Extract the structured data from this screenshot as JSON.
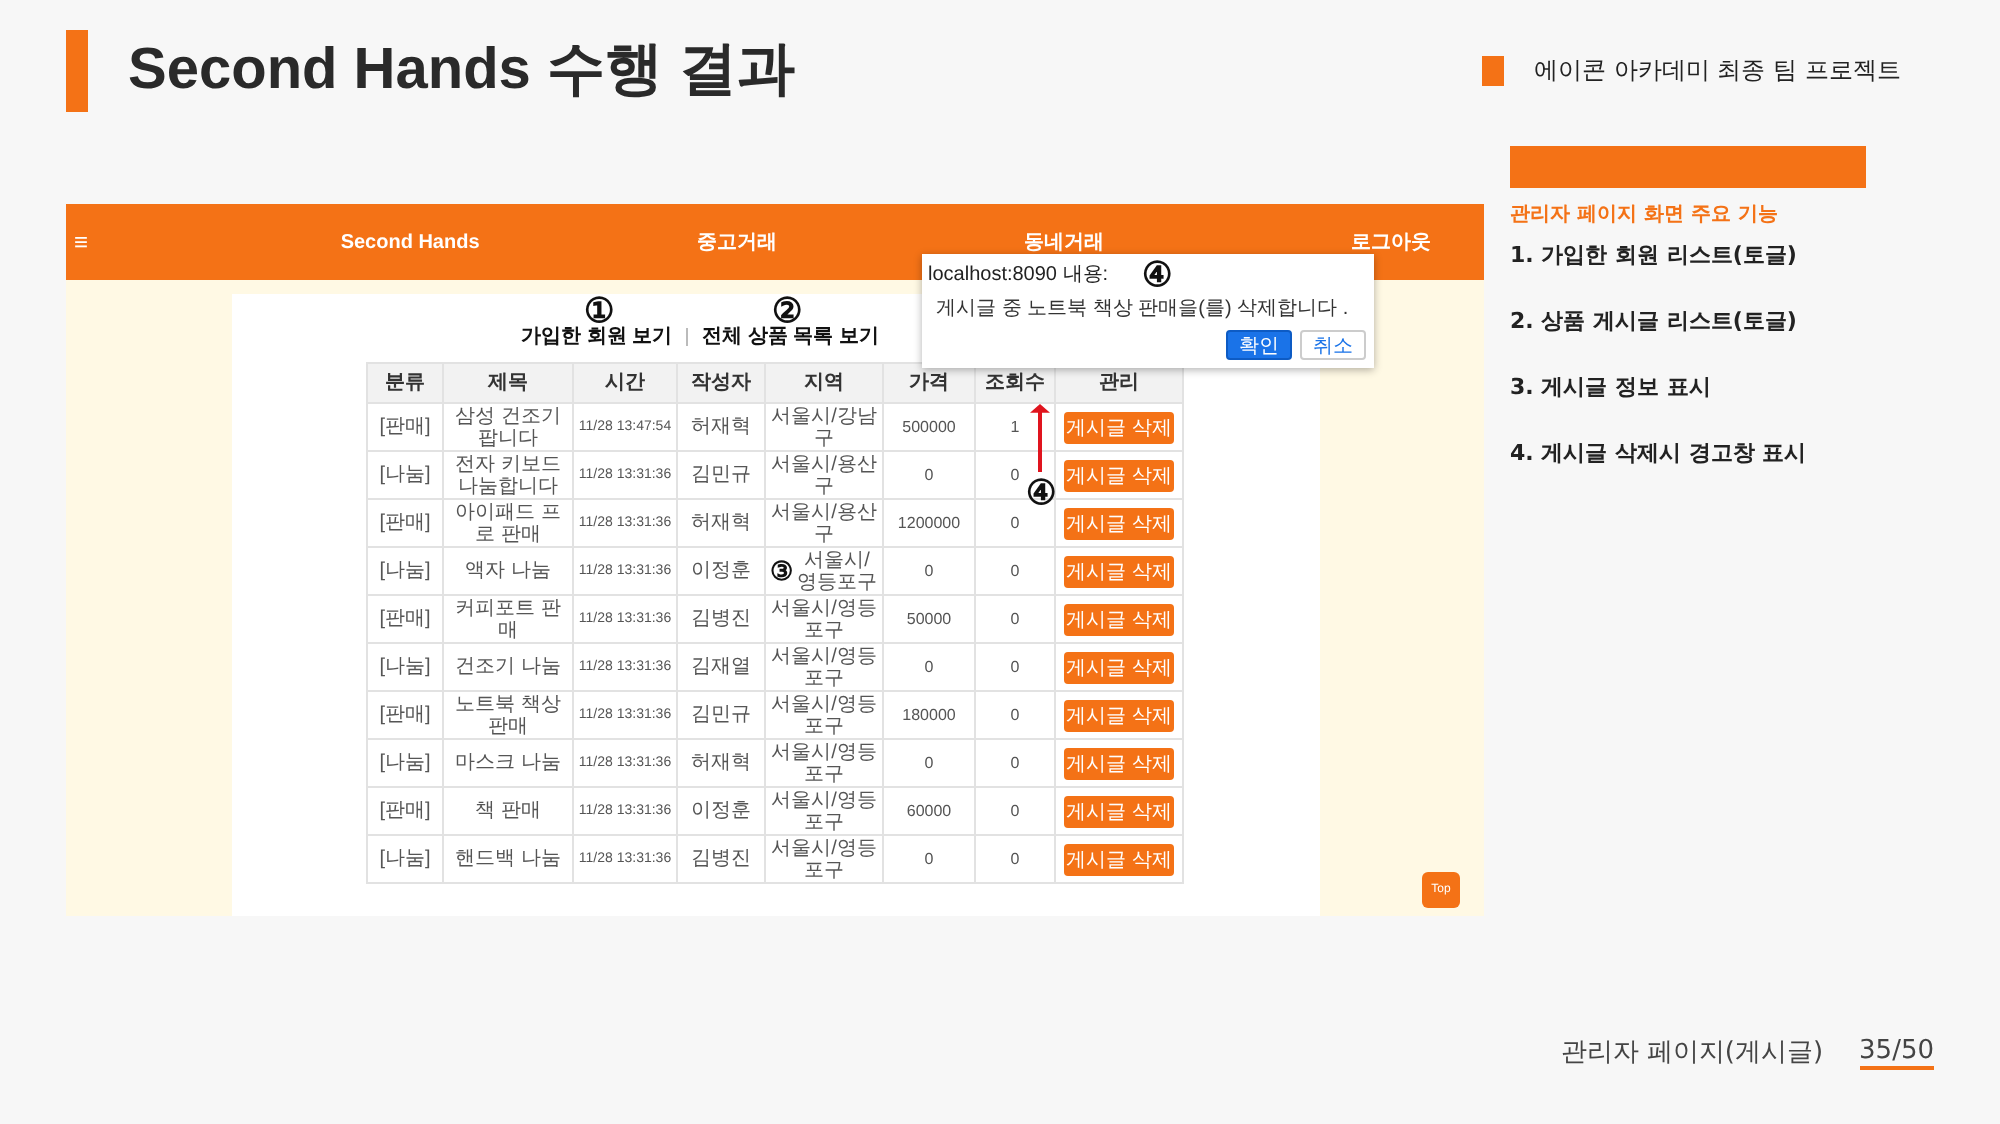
{
  "slide": {
    "title": "Second Hands 수행 결과",
    "project": "에이콘 아카데미 최종 팀 프로젝트"
  },
  "app": {
    "menu_icon": "≡",
    "nav": [
      "Second Hands",
      "중고거래",
      "동네거래",
      "로그아웃"
    ],
    "toggles": [
      {
        "label": "가입한 회원 보기"
      },
      {
        "label": "전체 상품 목록 보기"
      }
    ],
    "table": {
      "columns": [
        "분류",
        "제목",
        "시간",
        "작성자",
        "지역",
        "가격",
        "조회수",
        "관리"
      ],
      "rows": [
        {
          "cells": [
            "[판매]",
            "삼성 건조기 팝니다",
            "11/28 13:47:54",
            "허재혁",
            "서울시/강남구",
            "500000",
            "1"
          ],
          "action": "게시글 삭제"
        },
        {
          "cells": [
            "[나눔]",
            "전자 키보드 나눔합니다",
            "11/28 13:31:36",
            "김민규",
            "서울시/용산구",
            "0",
            "0"
          ],
          "action": "게시글 삭제"
        },
        {
          "cells": [
            "[판매]",
            "아이패드 프로 판매",
            "11/28 13:31:36",
            "허재혁",
            "서울시/용산구",
            "1200000",
            "0"
          ],
          "action": "게시글 삭제"
        },
        {
          "cells": [
            "[나눔]",
            "액자 나눔",
            "11/28 13:31:36",
            "이정훈",
            "서울시/영등포구",
            "0",
            "0"
          ],
          "action": "게시글 삭제"
        },
        {
          "cells": [
            "[판매]",
            "커피포트 판매",
            "11/28 13:31:36",
            "김병진",
            "서울시/영등포구",
            "50000",
            "0"
          ],
          "action": "게시글 삭제"
        },
        {
          "cells": [
            "[나눔]",
            "건조기 나눔",
            "11/28 13:31:36",
            "김재열",
            "서울시/영등포구",
            "0",
            "0"
          ],
          "action": "게시글 삭제"
        },
        {
          "cells": [
            "[판매]",
            "노트북 책상 판매",
            "11/28 13:31:36",
            "김민규",
            "서울시/영등포구",
            "180000",
            "0"
          ],
          "action": "게시글 삭제"
        },
        {
          "cells": [
            "[나눔]",
            "마스크 나눔",
            "11/28 13:31:36",
            "허재혁",
            "서울시/영등포구",
            "0",
            "0"
          ],
          "action": "게시글 삭제"
        },
        {
          "cells": [
            "[판매]",
            "책 판매",
            "11/28 13:31:36",
            "이정훈",
            "서울시/영등포구",
            "60000",
            "0"
          ],
          "action": "게시글 삭제"
        },
        {
          "cells": [
            "[나눔]",
            "핸드백 나눔",
            "11/28 13:31:36",
            "김병진",
            "서울시/영등포구",
            "0",
            "0"
          ],
          "action": "게시글 삭제"
        }
      ]
    },
    "top_button": "Top",
    "dialog": {
      "origin": "localhost:8090 내용:",
      "message": "게시글 중  노트북 책상 판매을(를) 삭제합니다 .",
      "buttons": [
        {
          "label": "확인",
          "primary": true
        },
        {
          "label": "취소",
          "primary": false
        }
      ]
    }
  },
  "annotations": [
    "①",
    "②",
    "③",
    "④",
    "④"
  ],
  "panel": {
    "heading": "관리자 페이지 화면 주요 기능",
    "items": [
      "1. 가입한 회원 리스트(토글)",
      "2. 상품 게시글 리스트(토글)",
      "3. 게시글 정보 표시",
      "4. 게시글 삭제시 경고창 표시"
    ]
  },
  "footer": {
    "section": "관리자 페이지(게시글)",
    "page": "35/50"
  }
}
